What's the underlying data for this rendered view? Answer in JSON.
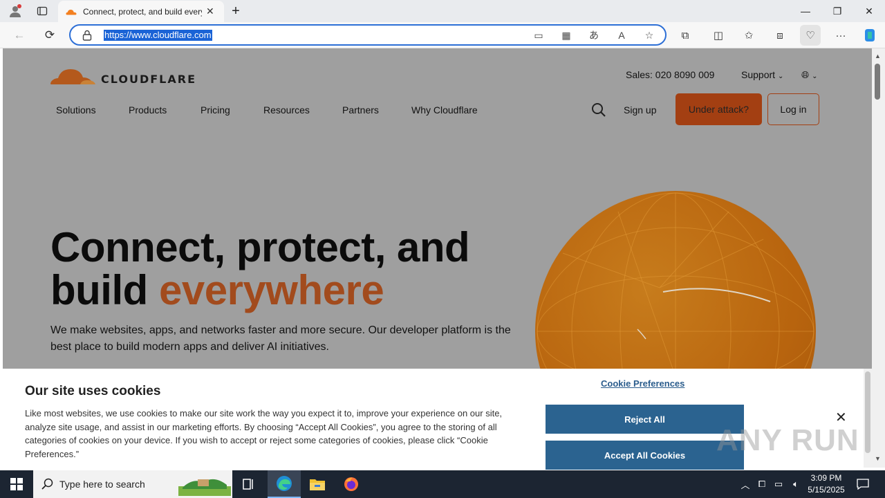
{
  "browser": {
    "tab_title": "Connect, protect, and build every",
    "url": "https://www.cloudflare.com"
  },
  "site": {
    "logo_text": "CLOUDFLARE",
    "sales": "Sales: 020 8090 009",
    "support": "Support",
    "nav": [
      "Solutions",
      "Products",
      "Pricing",
      "Resources",
      "Partners",
      "Why Cloudflare"
    ],
    "signup": "Sign up",
    "under_attack": "Under attack?",
    "login": "Log in",
    "hero_line1": "Connect, protect, and",
    "hero_line2_plain": "build ",
    "hero_line2_accent": "everywhere",
    "hero_sub": "We make websites, apps, and networks faster and more secure. Our developer platform is the best place to build modern apps and deliver AI initiatives.",
    "accent_color": "#a24b1d",
    "button_color": "#a33f12"
  },
  "cookie": {
    "heading": "Our site uses cookies",
    "body": "Like most websites, we use cookies to make our site work the way you expect it to, improve your experience on our site, analyze site usage, and assist in our marketing efforts. By choosing “Accept All Cookies”, you agree to the storing of all categories of cookies on your device. If you wish to accept or reject some categories of cookies, please click “Cookie Preferences.”",
    "preferences": "Cookie Preferences",
    "reject": "Reject All",
    "accept": "Accept All Cookies",
    "button_color": "#2b6390"
  },
  "watermark": "ANY RUN",
  "taskbar": {
    "search_placeholder": "Type here to search",
    "time": "3:09 PM",
    "date": "5/15/2025"
  }
}
